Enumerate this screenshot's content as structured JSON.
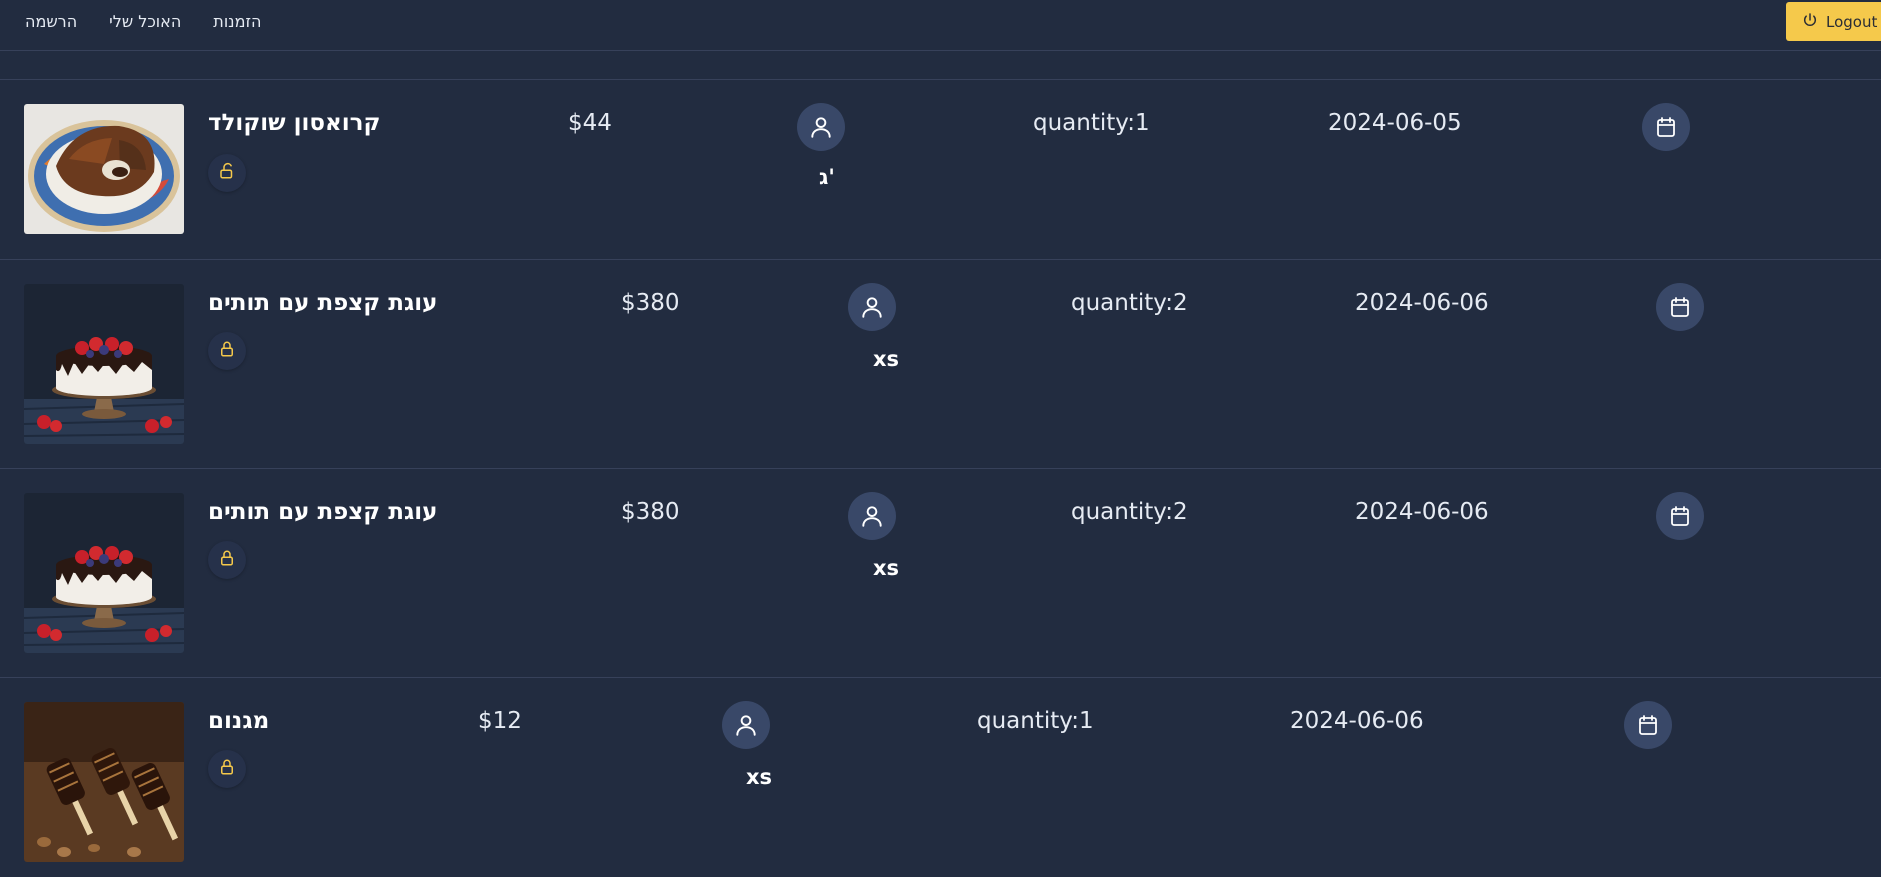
{
  "nav": {
    "links": [
      "הרשמה",
      "האוכל שלי",
      "הזמנות"
    ],
    "logout_label": "Logout"
  },
  "colors": {
    "background": "#222c40",
    "accent": "#f5c94b",
    "icon_circle": "#394868",
    "lock_icon": "#f5c94b"
  },
  "orders": [
    {
      "name": "קרואסון שוקולד",
      "price": "$44",
      "user": "ג'",
      "quantity": "quantity:1",
      "date": "2024-06-05",
      "lock_icon": "unlock-icon",
      "image": "croissant-image"
    },
    {
      "name": "עוגת קצפת עם תותים",
      "price": "$380",
      "user": "xs",
      "quantity": "quantity:2",
      "date": "2024-06-06",
      "lock_icon": "lock-icon",
      "image": "strawberry-cake-image"
    },
    {
      "name": "עוגת קצפת עם תותים",
      "price": "$380",
      "user": "xs",
      "quantity": "quantity:2",
      "date": "2024-06-06",
      "lock_icon": "lock-icon",
      "image": "strawberry-cake-image"
    },
    {
      "name": "מגנום",
      "price": "$12",
      "user": "xs",
      "quantity": "quantity:1",
      "date": "2024-06-06",
      "lock_icon": "lock-icon",
      "image": "ice-cream-bars-image"
    }
  ]
}
